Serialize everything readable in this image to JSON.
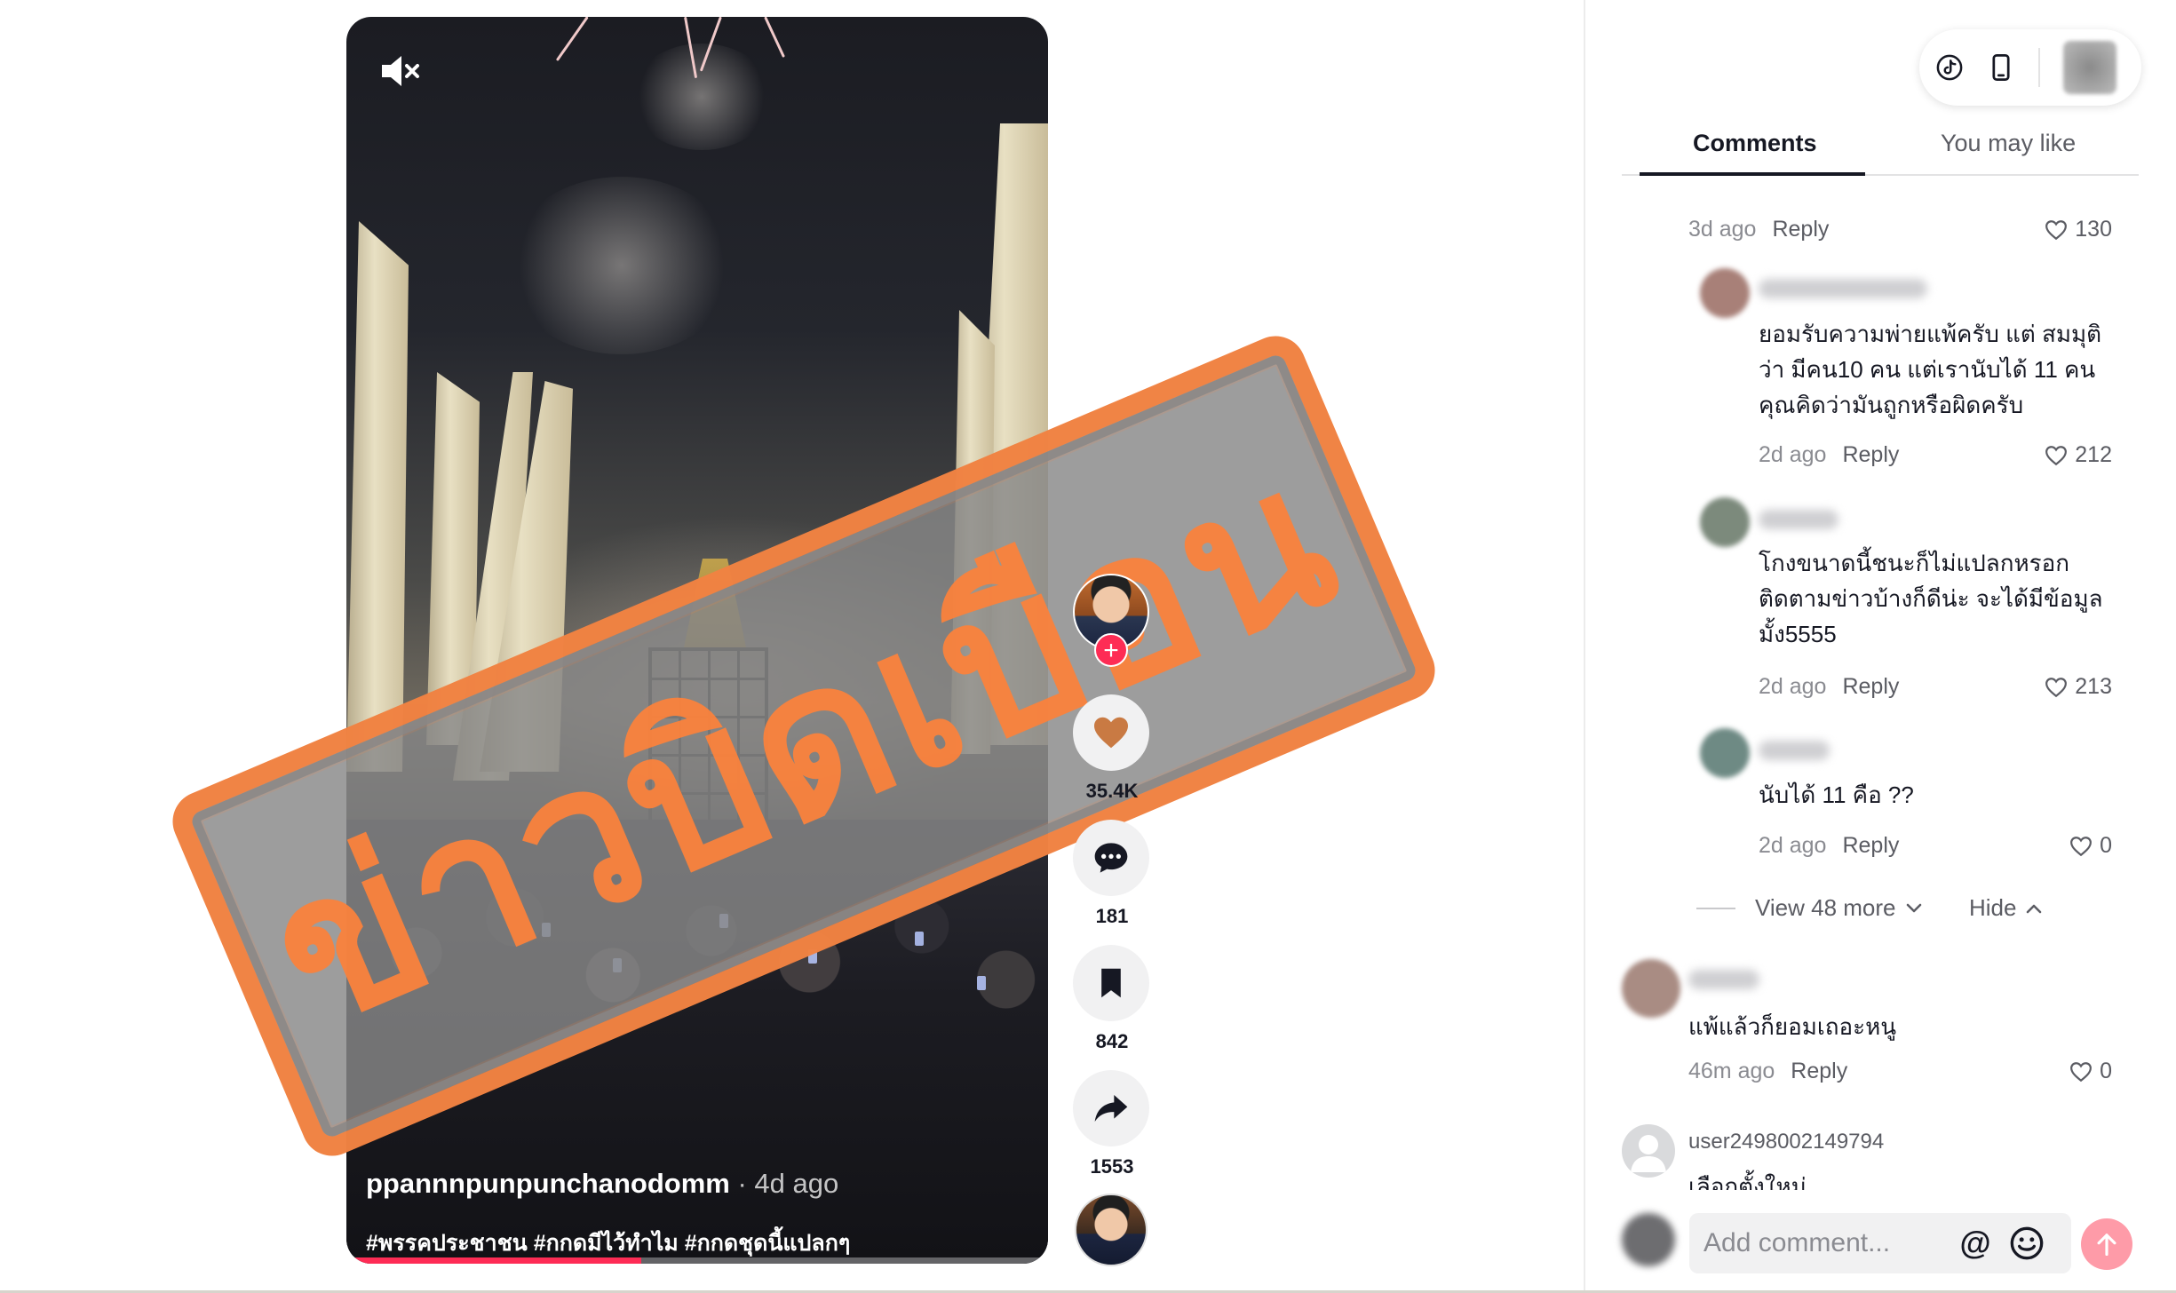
{
  "video": {
    "author": "ppannnpunpunchanodomm",
    "posted": " · 4d ago",
    "caption": "#พรรคประชาชน #กกดมีไว้ทำไม #กกดชุดนี้แปลกๆ",
    "progress_percent": 42
  },
  "stamp": {
    "text": "ข่าวบิดเบือน"
  },
  "actions": {
    "likes": "35.4K",
    "comments": "181",
    "saves": "842",
    "shares": "1553"
  },
  "tabs": {
    "comments": "Comments",
    "you_may_like": "You may like"
  },
  "comments": [
    {
      "text_lines": [],
      "time": "3d ago",
      "reply": "Reply",
      "likes": "130"
    },
    {
      "text_lines": [
        "ยอมรับความพ่ายแพ้ครับ แต่ สมมุติ",
        "ว่า มีคน10 คน แต่เรานับได้ 11 คน",
        "คุณคิดว่ามันถูกหรือผิดครับ"
      ],
      "time": "2d ago",
      "reply": "Reply",
      "likes": "212"
    },
    {
      "text_lines": [
        "โกงขนาดนี้ชนะก็ไม่แปลกหรอก",
        "ติดตามข่าวบ้างก็ดีน่ะ จะได้มีข้อมูล",
        "มั้ง5555"
      ],
      "time": "2d ago",
      "reply": "Reply",
      "likes": "213"
    },
    {
      "text_lines": [
        "นับได้ 11 คือ ??"
      ],
      "time": "2d ago",
      "reply": "Reply",
      "likes": "0"
    },
    {
      "text_lines": [
        "แพ้แล้วก็ยอมเถอะหนู"
      ],
      "time": "46m ago",
      "reply": "Reply",
      "likes": "0"
    }
  ],
  "replies_controls": {
    "view_more": "View 48 more",
    "hide": "Hide"
  },
  "last_comment": {
    "user": "user2498002149794",
    "text": "เลือกตั้งใหม่"
  },
  "comment_input": {
    "placeholder": "Add comment..."
  },
  "colors": {
    "accent": "#fe2c55",
    "stamp_orange": "#fa823c",
    "post_button": "#fe9ba8"
  },
  "icons": [
    "mute-icon",
    "heart-icon",
    "comment-bubble-icon",
    "bookmark-icon",
    "share-arrow-icon",
    "tiktok-logo-icon",
    "phone-icon",
    "at-sign-icon",
    "emoji-icon",
    "arrow-up-icon",
    "chevron-down-icon",
    "chevron-up-icon"
  ]
}
